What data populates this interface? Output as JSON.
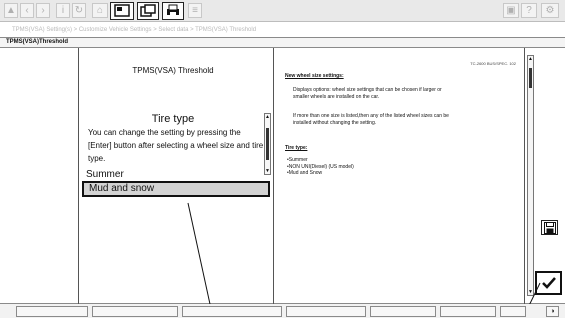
{
  "toolbar": {
    "icons": [
      "logo-icon",
      "back-icon",
      "forward-icon",
      "info-icon",
      "refresh-icon",
      "home-icon",
      "screen-icon",
      "split-screen-icon",
      "print-icon",
      "settings-icon",
      "bookmark-icon",
      "help-icon",
      "gear-icon"
    ]
  },
  "breadcrumb": "TPMS(VSA) Setting(s) > Customize Vehicle Settings > Select data > TPMS(VSA) Threshold",
  "window_title": "TPMS(VSA)Threshold",
  "left_panel": {
    "title": "TPMS(VSA) Threshold",
    "heading": "Tire type",
    "description": "You can change the setting by pressing the [Enter] button after selecting a wheel size and tire type.",
    "options": [
      "Summer",
      "Mud and snow"
    ],
    "selected_option": "Mud and snow"
  },
  "right_panel": {
    "corner_text": "TC-2600 BUS/SPEC. 102",
    "heading1": "New wheel size settings:",
    "para1": "Displays options: wheel size settings that can be chosen if larger or smaller wheels are installed on the car.",
    "para2": "If more than one size is listed,then any of the listed wheel sizes can be installed without changing the setting.",
    "heading2": "Tire type:",
    "list": [
      "Summer",
      "NON UNI(Diesel) (US model)",
      "Mud and Snow"
    ]
  },
  "buttons": {
    "save_icon": "floppy-disk-icon",
    "confirm_icon": "checkmark-icon"
  },
  "colors": {
    "selection_bg": "#d3d3d3",
    "toolbar_bg": "#e9e9e9"
  }
}
